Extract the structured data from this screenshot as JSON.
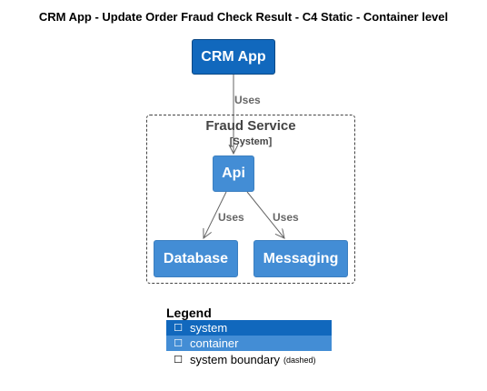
{
  "title": "CRM App - Update Order Fraud Check Result - C4 Static - Container level",
  "nodes": {
    "crm_app": "CRM App",
    "api": "Api",
    "database": "Database",
    "messaging": "Messaging"
  },
  "boundary": {
    "title": "Fraud Service",
    "type": "[System]"
  },
  "relations": {
    "crm_to_api": "Uses",
    "api_to_database": "Uses",
    "api_to_messaging": "Uses"
  },
  "legend": {
    "title": "Legend",
    "items": [
      {
        "icon": "☐",
        "label": "system",
        "note": ""
      },
      {
        "icon": "☐",
        "label": "container",
        "note": ""
      },
      {
        "icon": "☐",
        "label": "system boundary",
        "note": "(dashed)"
      }
    ]
  },
  "colors": {
    "system": "#1168bd",
    "container": "#438dd5",
    "relation": "#666666"
  }
}
